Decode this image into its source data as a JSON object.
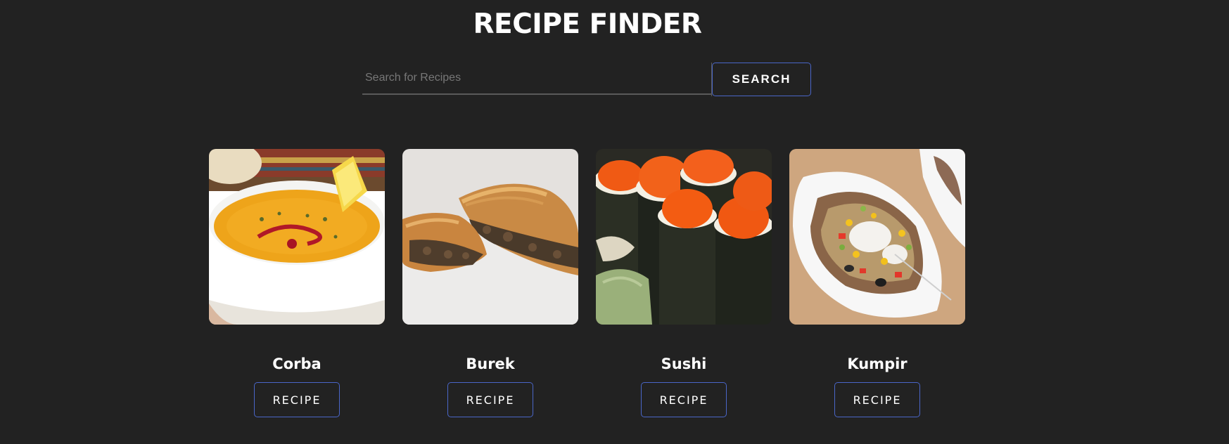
{
  "header": {
    "title": "RECIPE FINDER"
  },
  "search": {
    "placeholder": "Search for Recipes",
    "value": "",
    "button_label": "SEARCH"
  },
  "colors": {
    "background": "#222222",
    "accent_border": "#4a66c8",
    "text": "#ffffff"
  },
  "recipes": [
    {
      "name": "Corba",
      "button_label": "RECIPE",
      "image": "lentil-soup-photo"
    },
    {
      "name": "Burek",
      "button_label": "RECIPE",
      "image": "burek-pastry-photo"
    },
    {
      "name": "Sushi",
      "button_label": "RECIPE",
      "image": "sushi-rolls-photo"
    },
    {
      "name": "Kumpir",
      "button_label": "RECIPE",
      "image": "baked-potato-photo"
    }
  ]
}
